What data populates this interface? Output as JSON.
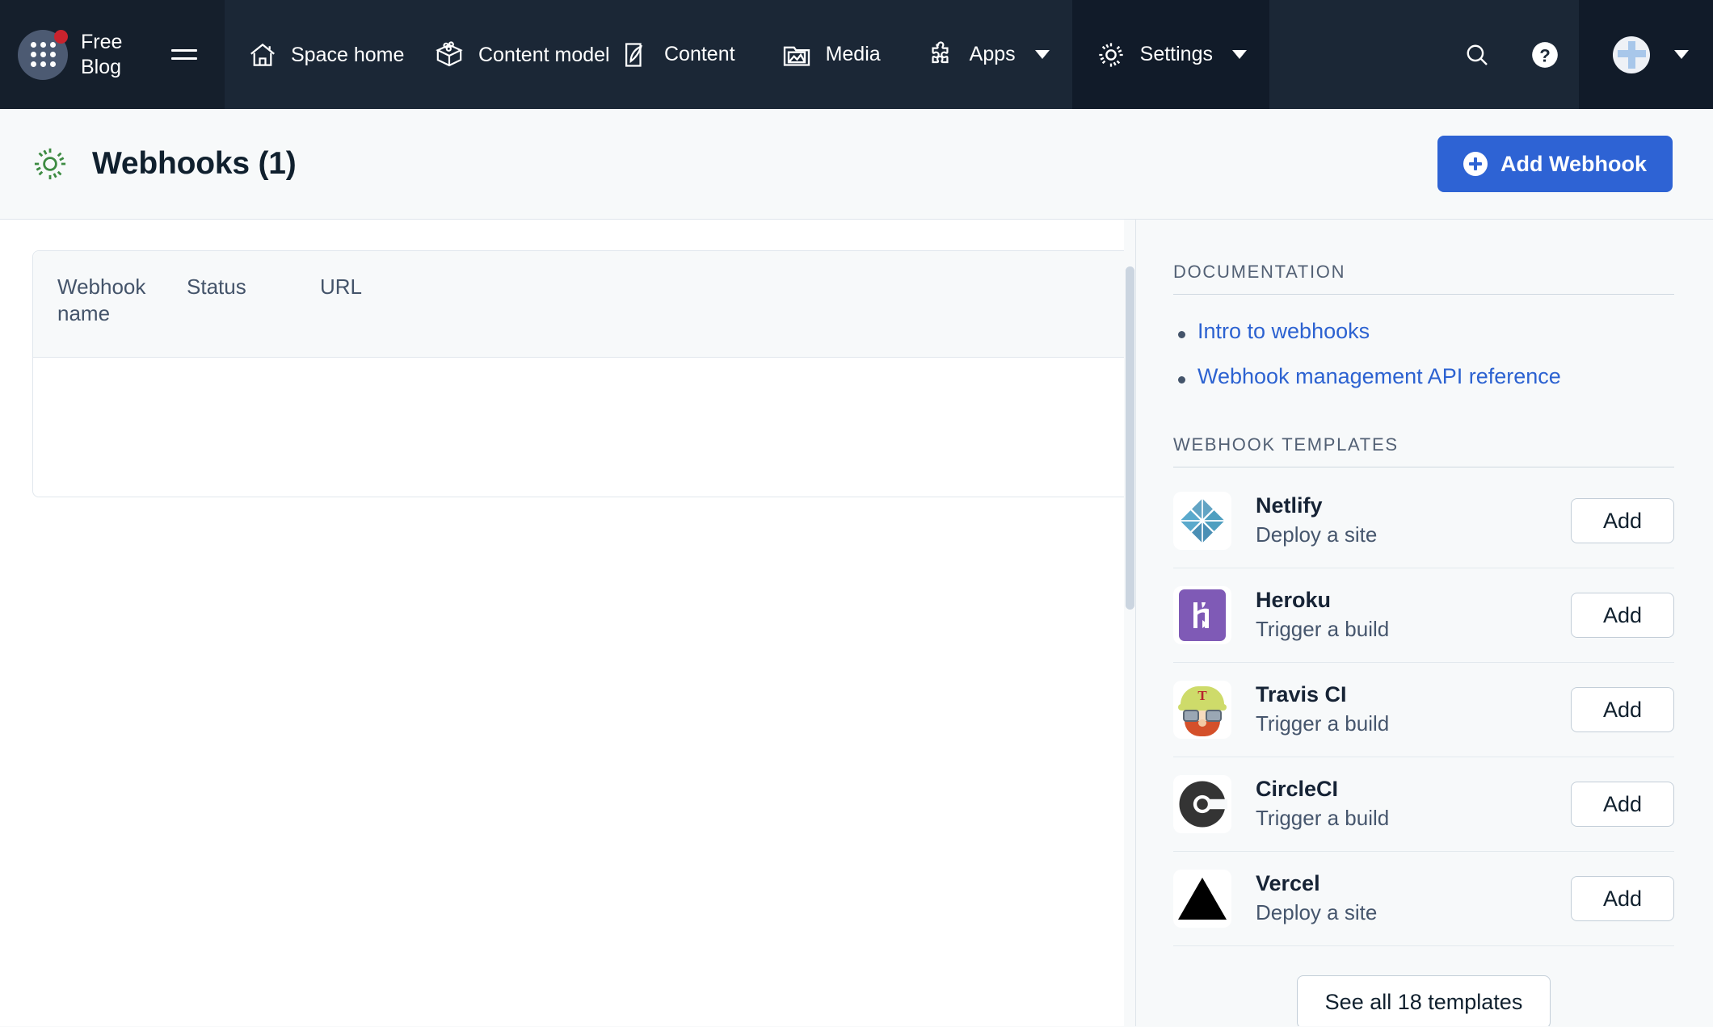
{
  "topnav": {
    "space_name": "Free Blog",
    "app_switcher_icon": "grid-apps-icon",
    "hamburger_icon": "menu-icon",
    "items": [
      {
        "label": "Space home",
        "icon": "home-icon",
        "active": false,
        "has_caret": false
      },
      {
        "label": "Content model",
        "icon": "content-model-icon",
        "active": false,
        "has_caret": false
      },
      {
        "label": "Content",
        "icon": "content-pen-icon",
        "active": false,
        "has_caret": false
      },
      {
        "label": "Media",
        "icon": "media-image-icon",
        "active": false,
        "has_caret": false
      },
      {
        "label": "Apps",
        "icon": "puzzle-icon",
        "active": false,
        "has_caret": true
      },
      {
        "label": "Settings",
        "icon": "gear-icon",
        "active": true,
        "has_caret": true
      }
    ],
    "search_icon": "search-icon",
    "help_icon": "help-question-icon",
    "avatar_icon": "user-avatar",
    "avatar_caret_icon": "chevron-down-icon"
  },
  "header": {
    "icon": "gear-icon",
    "title": "Webhooks (1)",
    "add_button_label": "Add Webhook",
    "add_button_icon": "plus-circle-icon",
    "accent_color": "#2e63d4"
  },
  "table": {
    "columns": [
      "Webhook name",
      "Status",
      "URL"
    ],
    "rows": []
  },
  "sidebar": {
    "documentation_heading": "DOCUMENTATION",
    "doc_links": [
      "Intro to webhooks",
      "Webhook management API reference"
    ],
    "templates_heading": "WEBHOOK TEMPLATES",
    "templates": [
      {
        "name": "Netlify",
        "desc": "Deploy a site",
        "logo": "netlify-logo",
        "add_label": "Add"
      },
      {
        "name": "Heroku",
        "desc": "Trigger a build",
        "logo": "heroku-logo",
        "add_label": "Add"
      },
      {
        "name": "Travis CI",
        "desc": "Trigger a build",
        "logo": "travisci-logo",
        "add_label": "Add"
      },
      {
        "name": "CircleCI",
        "desc": "Trigger a build",
        "logo": "circleci-logo",
        "add_label": "Add"
      },
      {
        "name": "Vercel",
        "desc": "Deploy a site",
        "logo": "vercel-logo",
        "add_label": "Add"
      }
    ],
    "see_all_label": "See all 18 templates",
    "link_color": "#2c62d1"
  }
}
